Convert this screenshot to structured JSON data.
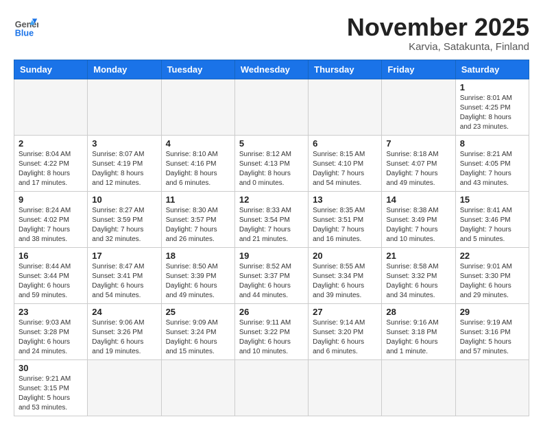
{
  "header": {
    "logo_general": "General",
    "logo_blue": "Blue",
    "month_title": "November 2025",
    "location": "Karvia, Satakunta, Finland"
  },
  "days_of_week": [
    "Sunday",
    "Monday",
    "Tuesday",
    "Wednesday",
    "Thursday",
    "Friday",
    "Saturday"
  ],
  "weeks": [
    [
      {
        "day": "",
        "info": ""
      },
      {
        "day": "",
        "info": ""
      },
      {
        "day": "",
        "info": ""
      },
      {
        "day": "",
        "info": ""
      },
      {
        "day": "",
        "info": ""
      },
      {
        "day": "",
        "info": ""
      },
      {
        "day": "1",
        "info": "Sunrise: 8:01 AM\nSunset: 4:25 PM\nDaylight: 8 hours\nand 23 minutes."
      }
    ],
    [
      {
        "day": "2",
        "info": "Sunrise: 8:04 AM\nSunset: 4:22 PM\nDaylight: 8 hours\nand 17 minutes."
      },
      {
        "day": "3",
        "info": "Sunrise: 8:07 AM\nSunset: 4:19 PM\nDaylight: 8 hours\nand 12 minutes."
      },
      {
        "day": "4",
        "info": "Sunrise: 8:10 AM\nSunset: 4:16 PM\nDaylight: 8 hours\nand 6 minutes."
      },
      {
        "day": "5",
        "info": "Sunrise: 8:12 AM\nSunset: 4:13 PM\nDaylight: 8 hours\nand 0 minutes."
      },
      {
        "day": "6",
        "info": "Sunrise: 8:15 AM\nSunset: 4:10 PM\nDaylight: 7 hours\nand 54 minutes."
      },
      {
        "day": "7",
        "info": "Sunrise: 8:18 AM\nSunset: 4:07 PM\nDaylight: 7 hours\nand 49 minutes."
      },
      {
        "day": "8",
        "info": "Sunrise: 8:21 AM\nSunset: 4:05 PM\nDaylight: 7 hours\nand 43 minutes."
      }
    ],
    [
      {
        "day": "9",
        "info": "Sunrise: 8:24 AM\nSunset: 4:02 PM\nDaylight: 7 hours\nand 38 minutes."
      },
      {
        "day": "10",
        "info": "Sunrise: 8:27 AM\nSunset: 3:59 PM\nDaylight: 7 hours\nand 32 minutes."
      },
      {
        "day": "11",
        "info": "Sunrise: 8:30 AM\nSunset: 3:57 PM\nDaylight: 7 hours\nand 26 minutes."
      },
      {
        "day": "12",
        "info": "Sunrise: 8:33 AM\nSunset: 3:54 PM\nDaylight: 7 hours\nand 21 minutes."
      },
      {
        "day": "13",
        "info": "Sunrise: 8:35 AM\nSunset: 3:51 PM\nDaylight: 7 hours\nand 16 minutes."
      },
      {
        "day": "14",
        "info": "Sunrise: 8:38 AM\nSunset: 3:49 PM\nDaylight: 7 hours\nand 10 minutes."
      },
      {
        "day": "15",
        "info": "Sunrise: 8:41 AM\nSunset: 3:46 PM\nDaylight: 7 hours\nand 5 minutes."
      }
    ],
    [
      {
        "day": "16",
        "info": "Sunrise: 8:44 AM\nSunset: 3:44 PM\nDaylight: 6 hours\nand 59 minutes."
      },
      {
        "day": "17",
        "info": "Sunrise: 8:47 AM\nSunset: 3:41 PM\nDaylight: 6 hours\nand 54 minutes."
      },
      {
        "day": "18",
        "info": "Sunrise: 8:50 AM\nSunset: 3:39 PM\nDaylight: 6 hours\nand 49 minutes."
      },
      {
        "day": "19",
        "info": "Sunrise: 8:52 AM\nSunset: 3:37 PM\nDaylight: 6 hours\nand 44 minutes."
      },
      {
        "day": "20",
        "info": "Sunrise: 8:55 AM\nSunset: 3:34 PM\nDaylight: 6 hours\nand 39 minutes."
      },
      {
        "day": "21",
        "info": "Sunrise: 8:58 AM\nSunset: 3:32 PM\nDaylight: 6 hours\nand 34 minutes."
      },
      {
        "day": "22",
        "info": "Sunrise: 9:01 AM\nSunset: 3:30 PM\nDaylight: 6 hours\nand 29 minutes."
      }
    ],
    [
      {
        "day": "23",
        "info": "Sunrise: 9:03 AM\nSunset: 3:28 PM\nDaylight: 6 hours\nand 24 minutes."
      },
      {
        "day": "24",
        "info": "Sunrise: 9:06 AM\nSunset: 3:26 PM\nDaylight: 6 hours\nand 19 minutes."
      },
      {
        "day": "25",
        "info": "Sunrise: 9:09 AM\nSunset: 3:24 PM\nDaylight: 6 hours\nand 15 minutes."
      },
      {
        "day": "26",
        "info": "Sunrise: 9:11 AM\nSunset: 3:22 PM\nDaylight: 6 hours\nand 10 minutes."
      },
      {
        "day": "27",
        "info": "Sunrise: 9:14 AM\nSunset: 3:20 PM\nDaylight: 6 hours\nand 6 minutes."
      },
      {
        "day": "28",
        "info": "Sunrise: 9:16 AM\nSunset: 3:18 PM\nDaylight: 6 hours\nand 1 minute."
      },
      {
        "day": "29",
        "info": "Sunrise: 9:19 AM\nSunset: 3:16 PM\nDaylight: 5 hours\nand 57 minutes."
      }
    ],
    [
      {
        "day": "30",
        "info": "Sunrise: 9:21 AM\nSunset: 3:15 PM\nDaylight: 5 hours\nand 53 minutes."
      },
      {
        "day": "",
        "info": ""
      },
      {
        "day": "",
        "info": ""
      },
      {
        "day": "",
        "info": ""
      },
      {
        "day": "",
        "info": ""
      },
      {
        "day": "",
        "info": ""
      },
      {
        "day": "",
        "info": ""
      }
    ]
  ]
}
